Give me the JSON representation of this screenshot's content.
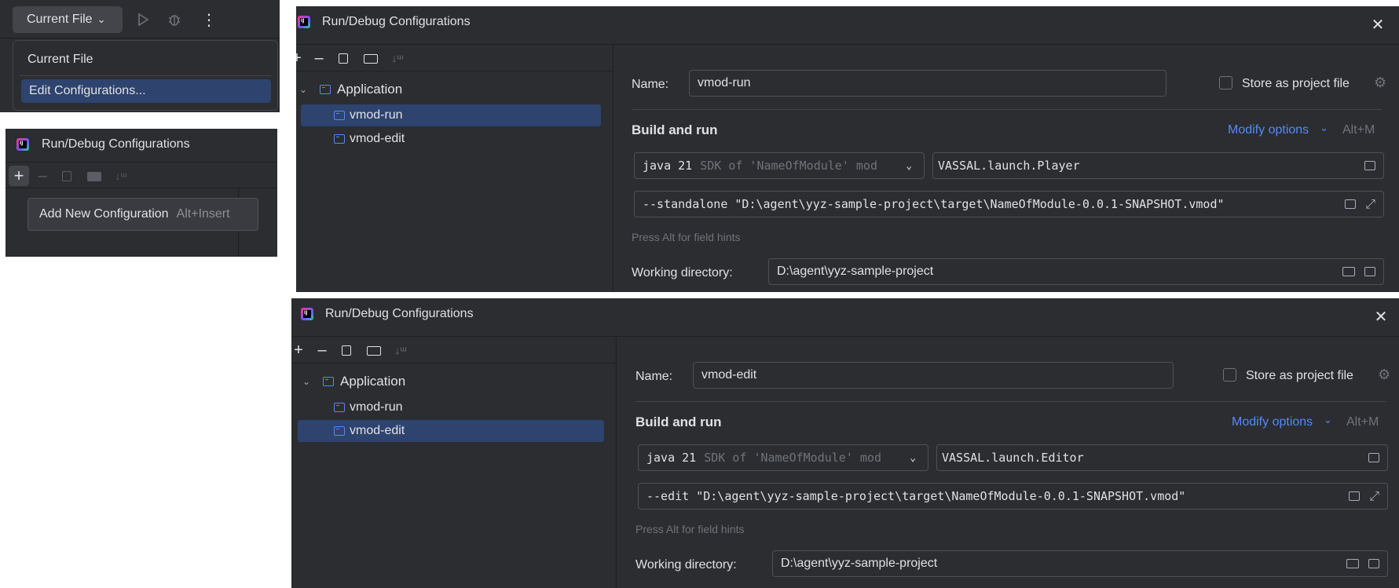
{
  "toolbar": {
    "run_config": "Current File",
    "menu": [
      "Current File",
      "Edit Configurations..."
    ]
  },
  "small_dialog": {
    "title": "Run/Debug Configurations",
    "tooltip_label": "Add New Configuration",
    "tooltip_shortcut": "Alt+Insert"
  },
  "dialogs": [
    {
      "title": "Run/Debug Configurations",
      "tree_root": "Application",
      "items": [
        "vmod-run",
        "vmod-edit"
      ],
      "selected": 0,
      "name_label": "Name:",
      "name_value": "vmod-run",
      "store_label": "Store as project file",
      "section": "Build and run",
      "modify_options": "Modify options",
      "modify_shortcut": "Alt+M",
      "jdk_main": "java 21",
      "jdk_hint": "SDK of 'NameOfModule' mod",
      "main_class": "VASSAL.launch.Player",
      "program_args": "--standalone \"D:\\agent\\yyz-sample-project\\target\\NameOfModule-0.0.1-SNAPSHOT.vmod\"",
      "field_hint": "Press Alt for field hints",
      "workdir_label": "Working directory:",
      "workdir_value": "D:\\agent\\yyz-sample-project"
    },
    {
      "title": "Run/Debug Configurations",
      "tree_root": "Application",
      "items": [
        "vmod-run",
        "vmod-edit"
      ],
      "selected": 1,
      "name_label": "Name:",
      "name_value": "vmod-edit",
      "store_label": "Store as project file",
      "section": "Build and run",
      "modify_options": "Modify options",
      "modify_shortcut": "Alt+M",
      "jdk_main": "java 21",
      "jdk_hint": "SDK of 'NameOfModule' mod",
      "main_class": "VASSAL.launch.Editor",
      "program_args": "--edit \"D:\\agent\\yyz-sample-project\\target\\NameOfModule-0.0.1-SNAPSHOT.vmod\"",
      "field_hint": "Press Alt for field hints",
      "workdir_label": "Working directory:",
      "workdir_value": "D:\\agent\\yyz-sample-project"
    }
  ],
  "colors": {
    "panel": "#2b2d30",
    "dark": "#1e1f22",
    "selection": "#2e436e",
    "accent": "#548af7"
  }
}
